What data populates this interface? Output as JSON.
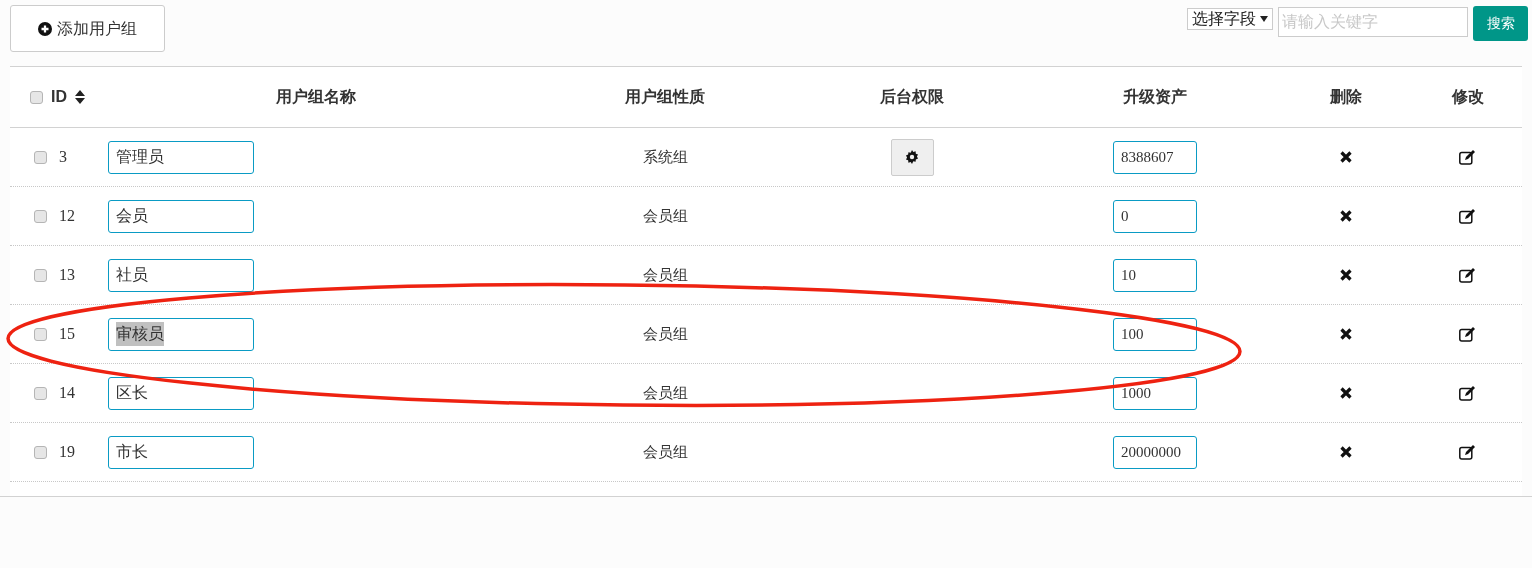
{
  "toolbar": {
    "add_button": "添加用户组",
    "field_select": "选择字段",
    "keyword_placeholder": "请输入关键字",
    "search_button": "搜索"
  },
  "table": {
    "select_all_checked": false,
    "columns": [
      "ID",
      "用户组名称",
      "用户组性质",
      "后台权限",
      "升级资产",
      "删除",
      "修改"
    ],
    "rows": [
      {
        "checked": false,
        "id": "3",
        "name": "管理员",
        "name_highlighted": false,
        "nature": "系统组",
        "permission_button": true,
        "assets": "8388607"
      },
      {
        "checked": false,
        "id": "12",
        "name": "会员",
        "name_highlighted": false,
        "nature": "会员组",
        "permission_button": false,
        "assets": "0"
      },
      {
        "checked": false,
        "id": "13",
        "name": "社员",
        "name_highlighted": false,
        "nature": "会员组",
        "permission_button": false,
        "assets": "10"
      },
      {
        "checked": false,
        "id": "15",
        "name": "审核员",
        "name_highlighted": true,
        "nature": "会员组",
        "permission_button": false,
        "assets": "100"
      },
      {
        "checked": false,
        "id": "14",
        "name": "区长",
        "name_highlighted": false,
        "nature": "会员组",
        "permission_button": false,
        "assets": "1000"
      },
      {
        "checked": false,
        "id": "19",
        "name": "市长",
        "name_highlighted": false,
        "nature": "会员组",
        "permission_button": false,
        "assets": "20000000"
      }
    ]
  },
  "annotation": {
    "kind": "ellipse",
    "color": "#ee2211"
  }
}
